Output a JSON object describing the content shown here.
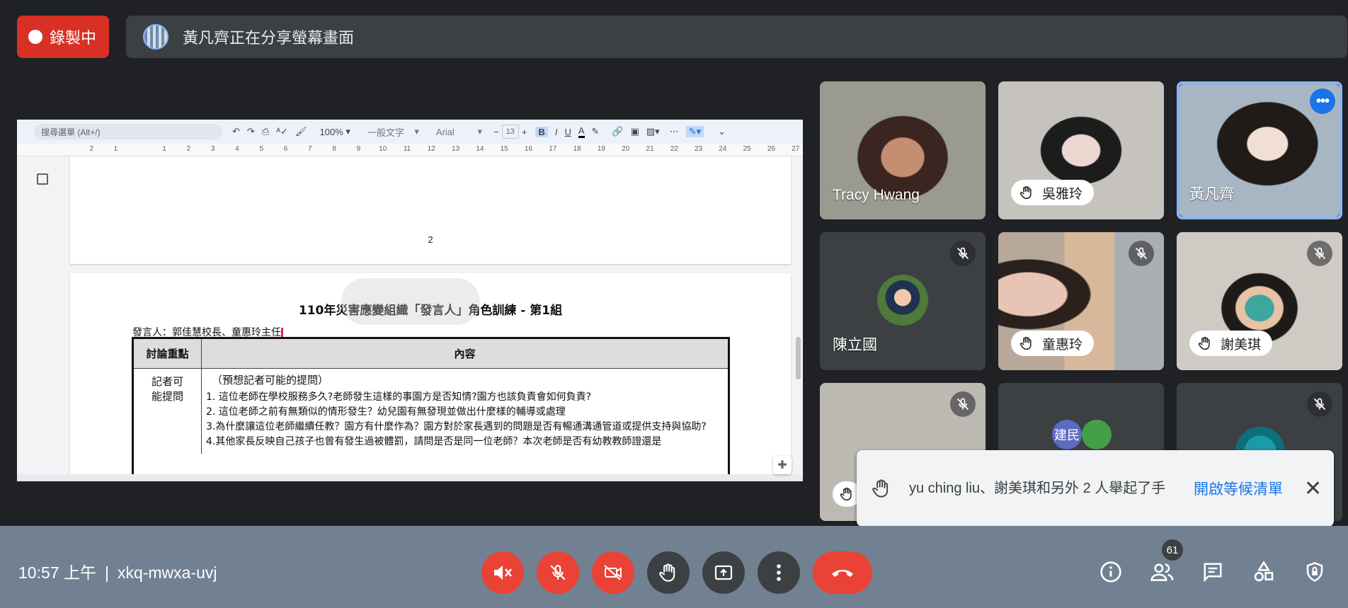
{
  "recording": {
    "label": "錄製中"
  },
  "share_bar": {
    "text": "黃凡齊正在分享螢幕畫面"
  },
  "doc": {
    "menu_search_placeholder": "搜尋選單 (Alt+/)",
    "zoom": "100%",
    "style": "一般文字",
    "font": "Arial",
    "font_size": "13",
    "ruler": [
      "2",
      "1",
      "",
      "1",
      "2",
      "3",
      "4",
      "5",
      "6",
      "7",
      "8",
      "9",
      "10",
      "11",
      "12",
      "13",
      "14",
      "15",
      "16",
      "17",
      "18",
      "19",
      "20",
      "21",
      "22",
      "23",
      "24",
      "25",
      "26",
      "27"
    ],
    "page_number": "2",
    "title": "110年災害應變組織「發言人」角色訓練 - 第1組",
    "speaker_line": "發言人：郭佳慧校長、童惠玲主任",
    "table": {
      "headers": [
        "討論重點",
        "內容"
      ],
      "row_label": "記者可能提問",
      "row_intro": "（預想記者可能的提問）",
      "row_lines": [
        "1. 這位老師在學校服務多久?老師發生這樣的事園方是否知情?園方也該負責會如何負責?",
        "2. 這位老師之前有無類似的情形發生？幼兒園有無發現並做出什麼樣的輔導或處理",
        "3.為什麼讓這位老師繼續任教？園方有什麼作為？園方對於家長遇到的問題是否有暢通溝通管道或提供支持與協助?",
        "4.其他家長反映自己孩子也曾有發生過被體罰，請問是否是同一位老師？本次老師是否有幼教教師證還是"
      ]
    }
  },
  "participants": [
    {
      "name": "Tracy Hwang",
      "hand": false,
      "muted": false
    },
    {
      "name": "吳雅玲",
      "hand": true,
      "muted": false
    },
    {
      "name": "黃凡齊",
      "hand": false,
      "muted": false,
      "active": true
    },
    {
      "name": "陳立國",
      "hand": false,
      "muted": true
    },
    {
      "name": "童惠玲",
      "hand": true,
      "muted": true
    },
    {
      "name": "謝美琪",
      "hand": true,
      "muted": true
    },
    {
      "name": "",
      "hand": true,
      "muted": true
    },
    {
      "name": "建民",
      "hand": false,
      "muted": false
    },
    {
      "name": "",
      "hand": false,
      "muted": true
    }
  ],
  "toast": {
    "text": "yu ching liu、謝美琪和另外 2 人舉起了手",
    "action": "開啟等候清單",
    "close_icon": "close-icon"
  },
  "bottom": {
    "time": "10:57 上午",
    "separator": "|",
    "meeting_code": "xkq-mwxa-uvj",
    "people_count": "61"
  },
  "colors": {
    "red": "#ea4335",
    "blue": "#1a73e8",
    "bar": "#718192"
  }
}
